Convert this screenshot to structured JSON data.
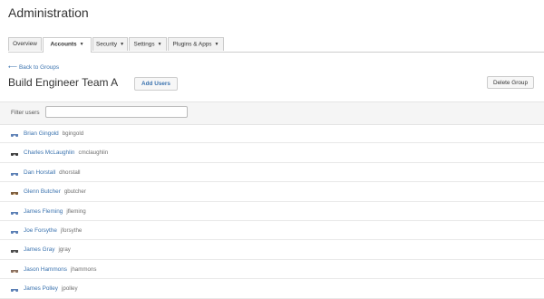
{
  "header": {
    "title": "Administration"
  },
  "tabs": [
    {
      "label": "Overview",
      "active": false,
      "has_dropdown": false
    },
    {
      "label": "Accounts",
      "active": true,
      "has_dropdown": true
    },
    {
      "label": "Security",
      "active": false,
      "has_dropdown": true
    },
    {
      "label": "Settings",
      "active": false,
      "has_dropdown": true
    },
    {
      "label": "Plugins & Apps",
      "active": false,
      "has_dropdown": true
    }
  ],
  "back_link": {
    "label": "Back to Groups",
    "icon": "back-arrow-icon"
  },
  "group": {
    "title": "Build Engineer Team A"
  },
  "buttons": {
    "add_users": "Add Users",
    "delete_group": "Delete Group"
  },
  "filter": {
    "label": "Filter users",
    "value": "",
    "placeholder": ""
  },
  "users": [
    {
      "name": "Brian Gingold",
      "username": "bgingold",
      "avatar_color": "#5b7fb5"
    },
    {
      "name": "Charles McLaughlin",
      "username": "cmclaughlin",
      "avatar_color": "#3a3a3a"
    },
    {
      "name": "Dan Horstall",
      "username": "dhorstall",
      "avatar_color": "#5b7fb5"
    },
    {
      "name": "Glenn Butcher",
      "username": "gbutcher",
      "avatar_color": "#7a5a3a"
    },
    {
      "name": "James Fleming",
      "username": "jfleming",
      "avatar_color": "#5b7fb5"
    },
    {
      "name": "Joe Forsythe",
      "username": "jforsythe",
      "avatar_color": "#5b7fb5"
    },
    {
      "name": "James Gray",
      "username": "jgray",
      "avatar_color": "#4a4a4a"
    },
    {
      "name": "Jason Hammons",
      "username": "jhammons",
      "avatar_color": "#8a7060"
    },
    {
      "name": "James Polley",
      "username": "jpolley",
      "avatar_color": "#5b7fb5"
    }
  ],
  "colors": {
    "link": "#3b73af",
    "border": "#cccccc",
    "filter_bg": "#f5f5f5"
  }
}
